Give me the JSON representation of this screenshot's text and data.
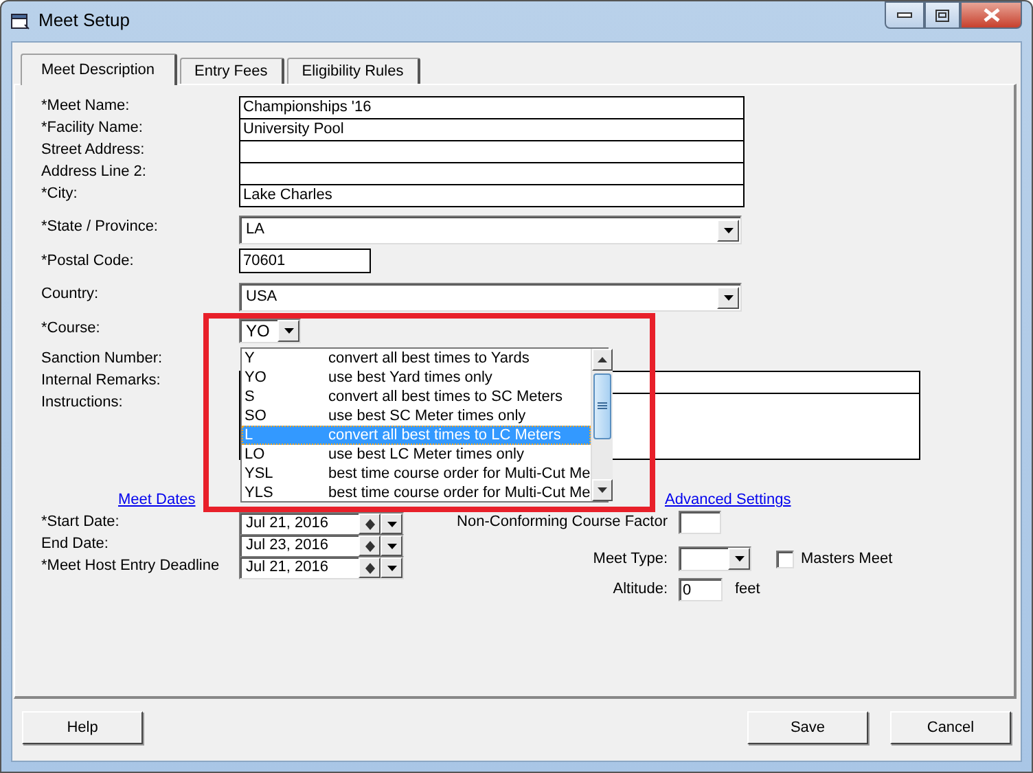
{
  "window": {
    "title": "Meet Setup"
  },
  "tabs": [
    {
      "label": "Meet Description",
      "selected": true
    },
    {
      "label": "Entry Fees",
      "selected": false
    },
    {
      "label": "Eligibility Rules",
      "selected": false
    }
  ],
  "fields": [
    {
      "kind": "text",
      "label": "*Meet Name:",
      "value": "Championships '16"
    },
    {
      "kind": "text",
      "label": "*Facility Name:",
      "value": "University Pool"
    },
    {
      "kind": "text",
      "label": "Street Address:"
    },
    {
      "kind": "text",
      "label": "Address Line 2:"
    },
    {
      "kind": "text",
      "label": "*City:",
      "value": "Lake Charles"
    },
    {
      "kind": "select",
      "label": "*State / Province:",
      "value": "LA"
    },
    {
      "kind": "short",
      "label": "*Postal Code:",
      "value": "70601"
    },
    {
      "kind": "select",
      "label": "Country:",
      "value": "USA"
    },
    {
      "kind": "combo",
      "label": "*Course:",
      "value": "YO"
    }
  ],
  "remarks": [
    {
      "kind": "covered",
      "label": "Sanction Number:"
    },
    {
      "kind": "line",
      "label": "Internal Remarks:"
    },
    {
      "kind": "area",
      "label": "Instructions:"
    }
  ],
  "course_list": {
    "items": [
      {
        "code": "Y",
        "description": "convert all best times to Yards",
        "selected": false
      },
      {
        "code": "YO",
        "description": "use best Yard times only",
        "selected": false
      },
      {
        "code": "S",
        "description": "convert all best times to SC Meters",
        "selected": false
      },
      {
        "code": "SO",
        "description": "use best SC Meter times only",
        "selected": false
      },
      {
        "code": "L",
        "description": "convert all best times to LC Meters",
        "selected": true
      },
      {
        "code": "LO",
        "description": "use best LC Meter times only",
        "selected": false
      },
      {
        "code": "YSL",
        "description": "best time course order for Multi-Cut Me",
        "selected": false
      },
      {
        "code": "YLS",
        "description": "best time course order for Multi-Cut Me",
        "selected": false
      }
    ]
  },
  "meet_dates": {
    "heading": "Meet Dates",
    "rows": [
      {
        "label": "*Start Date:",
        "value": "Jul 21, 2016"
      },
      {
        "label": "End Date:",
        "value": "Jul 23, 2016"
      },
      {
        "label": "*Meet Host Entry Deadline",
        "value": "Jul 21, 2016"
      }
    ]
  },
  "advanced_settings": {
    "heading": "Advanced Settings",
    "course_factor": {
      "label": "Non-Conforming Course Factor"
    },
    "meet_type": {
      "label": "Meet Type:"
    },
    "masters": {
      "label": "Masters Meet",
      "checked": false
    },
    "altitude": {
      "label": "Altitude:",
      "value": "0",
      "unit": "feet"
    }
  },
  "left_buttons": [
    {
      "label": "Help"
    }
  ],
  "right_buttons": [
    {
      "label": "Save"
    },
    {
      "label": "Cancel"
    }
  ]
}
